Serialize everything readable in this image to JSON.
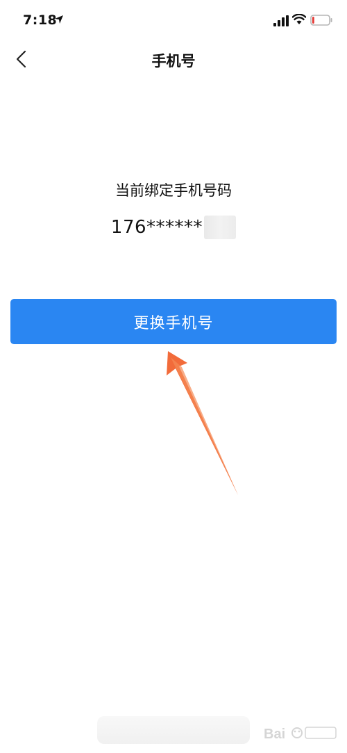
{
  "status_bar": {
    "time": "7:18",
    "location_icon": "location-arrow-icon",
    "signal_icon": "cellular-signal-icon",
    "wifi_icon": "wifi-icon",
    "battery_icon": "battery-low-icon",
    "battery_level": 0.12,
    "battery_color": "#e53935"
  },
  "nav": {
    "title": "手机号",
    "back_icon": "chevron-left-icon"
  },
  "main": {
    "bound_label": "当前绑定手机号码",
    "phone_number": "176******",
    "change_button_label": "更换手机号"
  },
  "colors": {
    "primary": "#2a86f2",
    "annotation_arrow": "#f26b3a"
  }
}
